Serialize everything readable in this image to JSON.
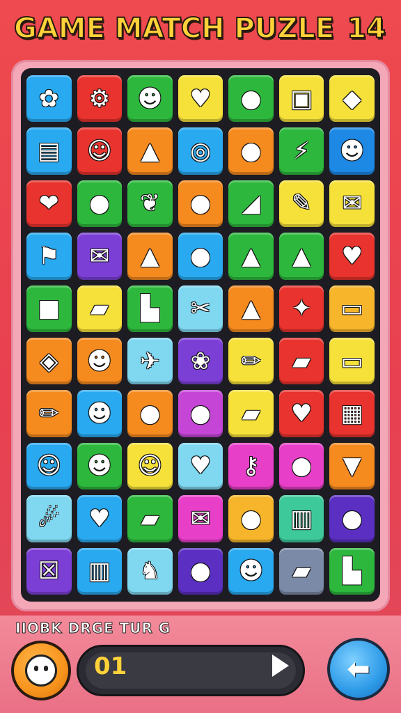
{
  "header": {
    "title": "GAME MATCH PUZLE",
    "level": "14"
  },
  "board": {
    "rows": 10,
    "cols": 7,
    "tiles": [
      {
        "color": "#29a9f0",
        "icon": "purple-flower-icon",
        "glyph": "✿"
      },
      {
        "color": "#e8332e",
        "icon": "gear-icon",
        "glyph": "⚙"
      },
      {
        "color": "#2db83d",
        "icon": "green-monster-icon",
        "glyph": "☻"
      },
      {
        "color": "#f6e13a",
        "icon": "heart-icon",
        "glyph": "♥"
      },
      {
        "color": "#2db83d",
        "icon": "pear-icon",
        "glyph": "●"
      },
      {
        "color": "#f6e13a",
        "icon": "treasure-chest-icon",
        "glyph": "▣"
      },
      {
        "color": "#f6e13a",
        "icon": "cheese-icon",
        "glyph": "◆"
      },
      {
        "color": "#29a9f0",
        "icon": "torn-paper-icon",
        "glyph": "▤"
      },
      {
        "color": "#e8332e",
        "icon": "white-monster-icon",
        "glyph": "☺"
      },
      {
        "color": "#f58a1f",
        "icon": "red-cone-icon",
        "glyph": "▲"
      },
      {
        "color": "#29a9f0",
        "icon": "donut-icon",
        "glyph": "◎"
      },
      {
        "color": "#f58a1f",
        "icon": "red-balloon-icon",
        "glyph": "●"
      },
      {
        "color": "#2db83d",
        "icon": "lightning-icon",
        "glyph": "⚡"
      },
      {
        "color": "#1e88e5",
        "icon": "orange-cat-icon",
        "glyph": "☻"
      },
      {
        "color": "#e8332e",
        "icon": "pink-heart-icon",
        "glyph": "❤"
      },
      {
        "color": "#2db83d",
        "icon": "lemon-icon",
        "glyph": "●"
      },
      {
        "color": "#2db83d",
        "icon": "orange-leaf-icon",
        "glyph": "❦"
      },
      {
        "color": "#f58a1f",
        "icon": "pink-ball-icon",
        "glyph": "●"
      },
      {
        "color": "#2db83d",
        "icon": "cheese-wedge-icon",
        "glyph": "◢"
      },
      {
        "color": "#f6e13a",
        "icon": "pencil-icon",
        "glyph": "✎"
      },
      {
        "color": "#f6e13a",
        "icon": "envelope-icon",
        "glyph": "✉"
      },
      {
        "color": "#29a9f0",
        "icon": "flag-icon",
        "glyph": "⚑"
      },
      {
        "color": "#7b3fd6",
        "icon": "envelope-icon",
        "glyph": "✉"
      },
      {
        "color": "#f58a1f",
        "icon": "orange-cone-icon",
        "glyph": "▲"
      },
      {
        "color": "#29a9f0",
        "icon": "orange-fruit-icon",
        "glyph": "●"
      },
      {
        "color": "#2db83d",
        "icon": "purple-cone-icon",
        "glyph": "▲"
      },
      {
        "color": "#2db83d",
        "icon": "party-hat-icon",
        "glyph": "▲"
      },
      {
        "color": "#e8332e",
        "icon": "yellow-heart-icon",
        "glyph": "♥"
      },
      {
        "color": "#2db83d",
        "icon": "red-box-icon",
        "glyph": "■"
      },
      {
        "color": "#f6e13a",
        "icon": "green-cucumber-icon",
        "glyph": "▰"
      },
      {
        "color": "#2db83d",
        "icon": "boot-icon",
        "glyph": "▙"
      },
      {
        "color": "#7fd7f0",
        "icon": "scissors-icon",
        "glyph": "✂"
      },
      {
        "color": "#f58a1f",
        "icon": "red-cone-icon",
        "glyph": "▲"
      },
      {
        "color": "#e8332e",
        "icon": "wand-icon",
        "glyph": "✦"
      },
      {
        "color": "#f6b52a",
        "icon": "battery-icon",
        "glyph": "▭"
      },
      {
        "color": "#f58a1f",
        "icon": "meat-icon",
        "glyph": "◈"
      },
      {
        "color": "#f58a1f",
        "icon": "orange-bear-icon",
        "glyph": "☻"
      },
      {
        "color": "#7fd7f0",
        "icon": "airplane-icon",
        "glyph": "✈"
      },
      {
        "color": "#7b3fd6",
        "icon": "salad-icon",
        "glyph": "❀"
      },
      {
        "color": "#f6e13a",
        "icon": "crayon-icon",
        "glyph": "✏"
      },
      {
        "color": "#e8332e",
        "icon": "white-eraser-icon",
        "glyph": "▰"
      },
      {
        "color": "#f6e13a",
        "icon": "ticket-icon",
        "glyph": "▭"
      },
      {
        "color": "#f58a1f",
        "icon": "crayon-icon",
        "glyph": "✏"
      },
      {
        "color": "#29a9f0",
        "icon": "yellow-robot-icon",
        "glyph": "☻"
      },
      {
        "color": "#f58a1f",
        "icon": "red-orange-icon",
        "glyph": "●"
      },
      {
        "color": "#c545d6",
        "icon": "pink-ball-icon",
        "glyph": "●"
      },
      {
        "color": "#f6e13a",
        "icon": "green-cucumber-icon",
        "glyph": "▰"
      },
      {
        "color": "#e8332e",
        "icon": "blue-heart-icon",
        "glyph": "♥"
      },
      {
        "color": "#e8332e",
        "icon": "card-icon",
        "glyph": "▦"
      },
      {
        "color": "#29a9f0",
        "icon": "red-face-icon",
        "glyph": "☺"
      },
      {
        "color": "#2db83d",
        "icon": "bear-icon",
        "glyph": "☻"
      },
      {
        "color": "#f6e13a",
        "icon": "white-monster-icon",
        "glyph": "☺"
      },
      {
        "color": "#7fd7f0",
        "icon": "red-heart-bubble-icon",
        "glyph": "♥"
      },
      {
        "color": "#e83fc8",
        "icon": "key-icon",
        "glyph": "⚷"
      },
      {
        "color": "#e83fc8",
        "icon": "orange-fruit-icon",
        "glyph": "●"
      },
      {
        "color": "#f58a1f",
        "icon": "carrot-icon",
        "glyph": "▼"
      },
      {
        "color": "#7fd7f0",
        "icon": "comet-icon",
        "glyph": "☄"
      },
      {
        "color": "#29a9f0",
        "icon": "heart-face-icon",
        "glyph": "♥"
      },
      {
        "color": "#2db83d",
        "icon": "chili-icon",
        "glyph": "▰"
      },
      {
        "color": "#e83fc8",
        "icon": "envelope-icon",
        "glyph": "✉"
      },
      {
        "color": "#f6b52a",
        "icon": "orange-fruit-icon",
        "glyph": "●"
      },
      {
        "color": "#3ec99a",
        "icon": "bench-icon",
        "glyph": "▥"
      },
      {
        "color": "#5a2fc2",
        "icon": "blue-ball-icon",
        "glyph": "●"
      },
      {
        "color": "#7b3fd6",
        "icon": "crate-icon",
        "glyph": "☒"
      },
      {
        "color": "#29a9f0",
        "icon": "basket-icon",
        "glyph": "▥"
      },
      {
        "color": "#7fd7f0",
        "icon": "green-dino-icon",
        "glyph": "♞"
      },
      {
        "color": "#5a2fc2",
        "icon": "purple-ball-icon",
        "glyph": "●"
      },
      {
        "color": "#29a9f0",
        "icon": "green-slime-icon",
        "glyph": "☻"
      },
      {
        "color": "#7b8aa6",
        "icon": "yellow-eraser-icon",
        "glyph": "▰"
      },
      {
        "color": "#2db83d",
        "icon": "desk-icon",
        "glyph": "▙"
      }
    ]
  },
  "footer": {
    "hint": "IIOBK DRGE TUR G",
    "moves": "01",
    "character_icon": "monster-face-icon",
    "play_icon": "play-icon",
    "back_icon": "back-arrow-icon",
    "back_glyph": "⬅"
  }
}
